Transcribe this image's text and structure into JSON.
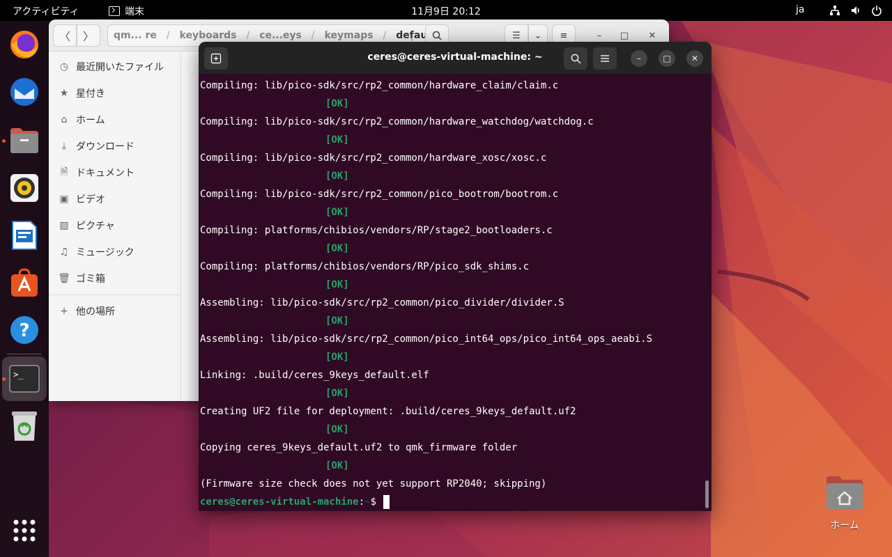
{
  "topbar": {
    "activities": "アクティビティ",
    "app_name": "端末",
    "clock": "11月9日  20:12",
    "language": "ja"
  },
  "dock": {
    "items": [
      "firefox-icon",
      "thunderbird-icon",
      "files-icon",
      "rhythmbox-icon",
      "writer-icon",
      "software-icon",
      "help-icon",
      "terminal-icon",
      "trash-icon",
      "app-grid-icon"
    ]
  },
  "files": {
    "path": [
      "qm... re",
      "keyboards",
      "ce...eys",
      "keymaps",
      "default"
    ],
    "sidebar": [
      {
        "label": "最近開いたファイル",
        "icon": "clock-icon"
      },
      {
        "label": "星付き",
        "icon": "star-icon"
      },
      {
        "label": "ホーム",
        "icon": "home-icon"
      },
      {
        "label": "ダウンロード",
        "icon": "download-icon"
      },
      {
        "label": "ドキュメント",
        "icon": "document-icon"
      },
      {
        "label": "ビデオ",
        "icon": "video-icon"
      },
      {
        "label": "ピクチャ",
        "icon": "picture-icon"
      },
      {
        "label": "ミュージック",
        "icon": "music-icon"
      },
      {
        "label": "ゴミ箱",
        "icon": "trash-icon"
      },
      {
        "label": "他の場所",
        "icon": "plus-icon"
      }
    ]
  },
  "terminal": {
    "title": "ceres@ceres-virtual-machine: ~",
    "lines": [
      {
        "text": "Compiling: lib/pico-sdk/src/rp2_common/hardware_claim/claim.c",
        "ok": false
      },
      {
        "text": "[OK]",
        "ok": true
      },
      {
        "text": "Compiling: lib/pico-sdk/src/rp2_common/hardware_watchdog/watchdog.c",
        "ok": false
      },
      {
        "text": "[OK]",
        "ok": true
      },
      {
        "text": "Compiling: lib/pico-sdk/src/rp2_common/hardware_xosc/xosc.c",
        "ok": false
      },
      {
        "text": "[OK]",
        "ok": true
      },
      {
        "text": "Compiling: lib/pico-sdk/src/rp2_common/pico_bootrom/bootrom.c",
        "ok": false
      },
      {
        "text": "[OK]",
        "ok": true
      },
      {
        "text": "Compiling: platforms/chibios/vendors/RP/stage2_bootloaders.c",
        "ok": false
      },
      {
        "text": "[OK]",
        "ok": true
      },
      {
        "text": "Compiling: platforms/chibios/vendors/RP/pico_sdk_shims.c",
        "ok": false
      },
      {
        "text": "[OK]",
        "ok": true
      },
      {
        "text": "Assembling: lib/pico-sdk/src/rp2_common/pico_divider/divider.S",
        "ok": false
      },
      {
        "text": "[OK]",
        "ok": true
      },
      {
        "text": "Assembling: lib/pico-sdk/src/rp2_common/pico_int64_ops/pico_int64_ops_aeabi.S",
        "ok": false
      },
      {
        "text": "[OK]",
        "ok": true
      },
      {
        "text": "Linking: .build/ceres_9keys_default.elf",
        "ok": false
      },
      {
        "text": "[OK]",
        "ok": true
      },
      {
        "text": "Creating UF2 file for deployment: .build/ceres_9keys_default.uf2",
        "ok": false
      },
      {
        "text": "[OK]",
        "ok": true
      },
      {
        "text": "Copying ceres_9keys_default.uf2 to qmk_firmware folder",
        "ok": false
      },
      {
        "text": "[OK]",
        "ok": true
      },
      {
        "text": "(Firmware size check does not yet support RP2040; skipping)",
        "ok": false
      }
    ],
    "prompt_user": "ceres@ceres-virtual-machine",
    "prompt_sep": ":",
    "prompt_path": "~",
    "prompt_symbol": "$ "
  },
  "desktop": {
    "home_label": "ホーム"
  },
  "colors": {
    "terminal_bg": "#300a24",
    "ok_green": "#26a269",
    "accent": "#e95420"
  }
}
